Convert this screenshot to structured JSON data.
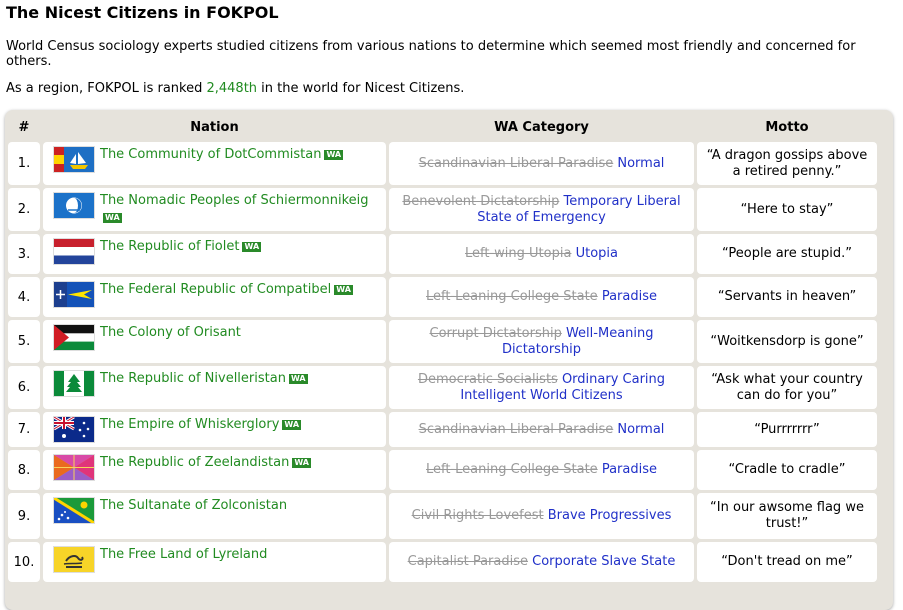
{
  "page": {
    "title": "The Nicest Citizens in FOKPOL",
    "description": "World Census sociology experts studied citizens from various nations to determine which seemed most friendly and concerned for others.",
    "rank_prefix": "As a region, FOKPOL is ranked ",
    "rank_value": "2,448th",
    "rank_suffix": " in the world for Nicest Citizens."
  },
  "table": {
    "headers": {
      "rank": "#",
      "nation": "Nation",
      "category": "WA Category",
      "motto": "Motto"
    },
    "wa_badge": "WA",
    "rows": [
      {
        "rank": "1.",
        "nation": "The Community of DotCommistan",
        "wa": true,
        "old": "Scandinavian Liberal Paradise",
        "new": "Normal",
        "motto": "“A dragon gossips above a retired penny.”",
        "flag": "dotcommistan"
      },
      {
        "rank": "2.",
        "nation": "The Nomadic Peoples of Schiermonnikeig",
        "wa": true,
        "old": "Benevolent Dictatorship",
        "new": "Temporary Liberal State of Emergency",
        "motto": "“Here to stay”",
        "flag": "schiermonnikeig"
      },
      {
        "rank": "3.",
        "nation": "The Republic of Fiolet",
        "wa": true,
        "old": "Left-wing Utopia",
        "new": "Utopia",
        "motto": "“People are stupid.”",
        "flag": "fiolet"
      },
      {
        "rank": "4.",
        "nation": "The Federal Republic of Compatibel",
        "wa": true,
        "old": "Left-Leaning College State",
        "new": "Paradise",
        "motto": "“Servants in heaven”",
        "flag": "compatibel"
      },
      {
        "rank": "5.",
        "nation": "The Colony of Orisant",
        "wa": false,
        "old": "Corrupt Dictatorship",
        "new": "Well-Meaning Dictatorship",
        "motto": "“Woitkensdorp is gone”",
        "flag": "orisant"
      },
      {
        "rank": "6.",
        "nation": "The Republic of Nivelleristan",
        "wa": true,
        "old": "Democratic Socialists",
        "new": "Ordinary Caring Intelligent World Citizens",
        "motto": "“Ask what your country can do for you”",
        "flag": "nivelleristan"
      },
      {
        "rank": "7.",
        "nation": "The Empire of Whiskerglory",
        "wa": true,
        "old": "Scandinavian Liberal Paradise",
        "new": "Normal",
        "motto": "“Purrrrrrr”",
        "flag": "whiskerglory"
      },
      {
        "rank": "8.",
        "nation": "The Republic of Zeelandistan",
        "wa": true,
        "old": "Left-Leaning College State",
        "new": "Paradise",
        "motto": "“Cradle to cradle”",
        "flag": "zeelandistan"
      },
      {
        "rank": "9.",
        "nation": "The Sultanate of Zolconistan",
        "wa": false,
        "old": "Civil Rights Lovefest",
        "new": "Brave Progressives",
        "motto": "“In our awsome flag we trust!”",
        "flag": "zolconistan"
      },
      {
        "rank": "10.",
        "nation": "The Free Land of Lyreland",
        "wa": false,
        "old": "Capitalist Paradise",
        "new": "Corporate Slave State",
        "motto": "“Don't tread on me”",
        "flag": "lyreland"
      }
    ]
  }
}
